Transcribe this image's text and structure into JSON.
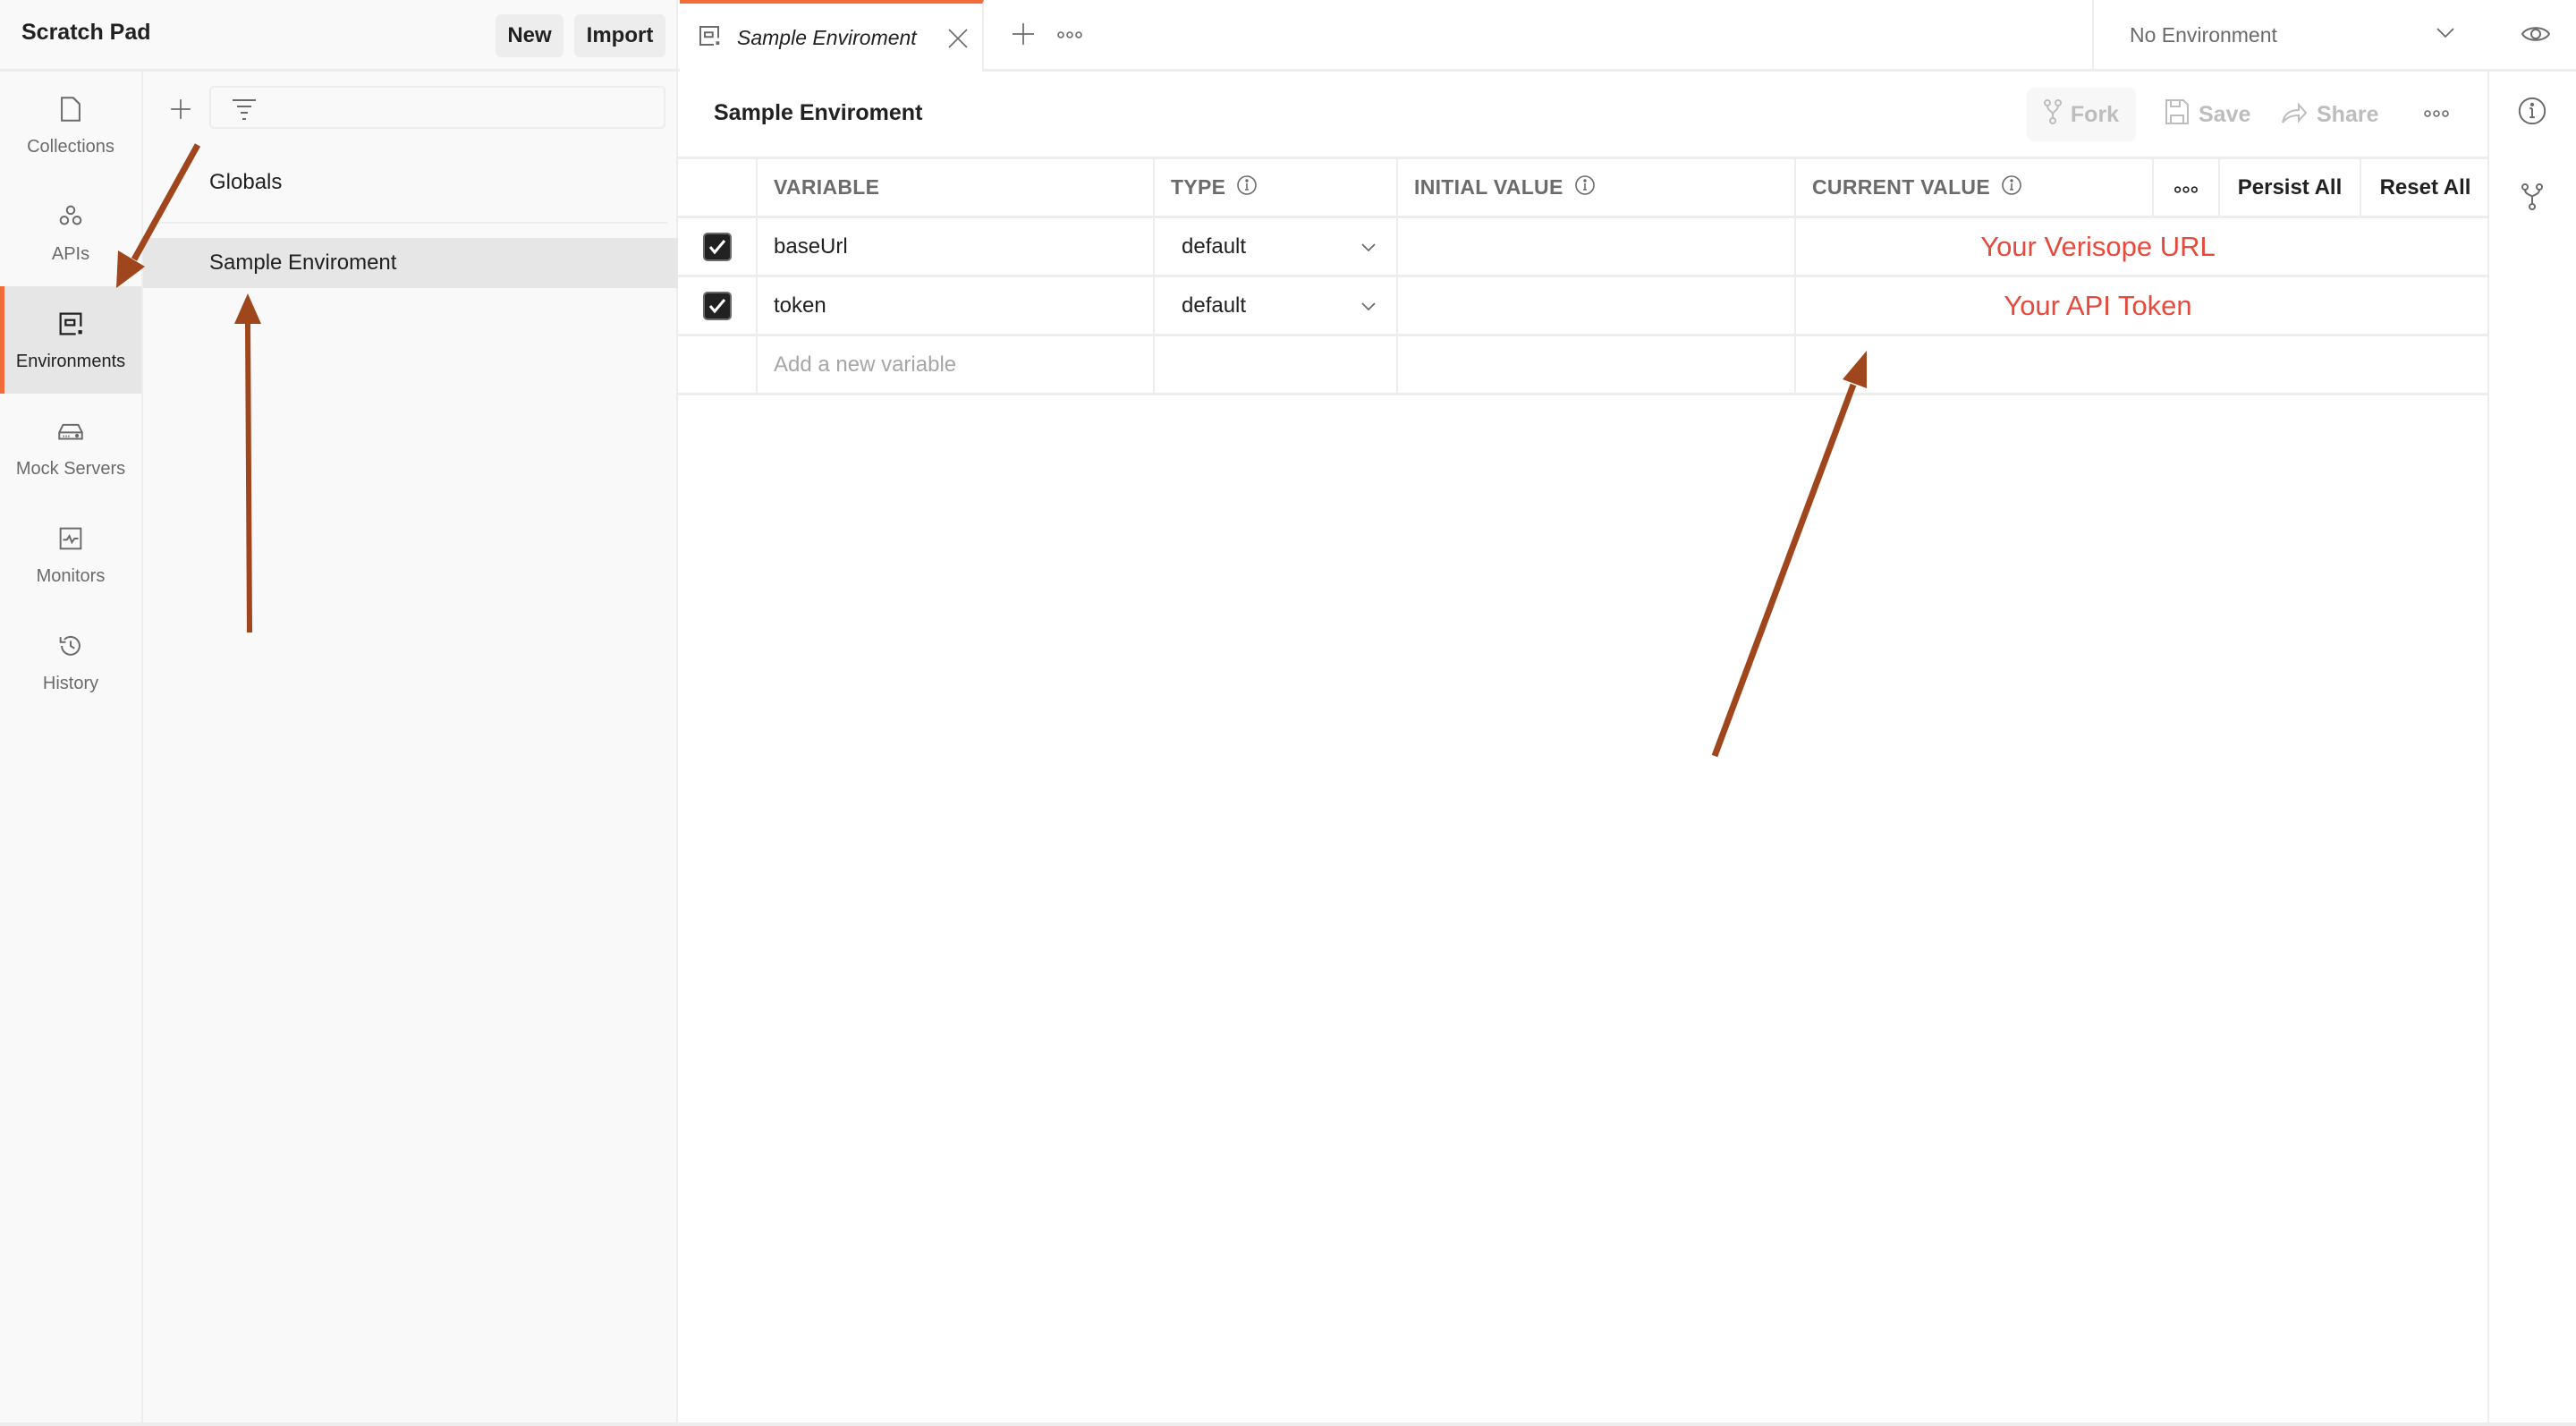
{
  "workspace": {
    "title": "Scratch Pad",
    "new_label": "New",
    "import_label": "Import"
  },
  "sidebar": {
    "items": [
      {
        "label": "Collections",
        "icon": "collections-icon",
        "active": false
      },
      {
        "label": "APIs",
        "icon": "apis-icon",
        "active": false
      },
      {
        "label": "Environments",
        "icon": "environments-icon",
        "active": true
      },
      {
        "label": "Mock Servers",
        "icon": "mock-servers-icon",
        "active": false
      },
      {
        "label": "Monitors",
        "icon": "monitors-icon",
        "active": false
      },
      {
        "label": "History",
        "icon": "history-icon",
        "active": false
      }
    ]
  },
  "env_panel": {
    "filter_placeholder": "",
    "items": [
      {
        "label": "Globals",
        "selected": false
      },
      {
        "label": "Sample Enviroment",
        "selected": true
      }
    ]
  },
  "tabs": {
    "active_tab": "Sample Enviroment",
    "environment_selector": "No Environment"
  },
  "main": {
    "title": "Sample Enviroment",
    "actions": {
      "fork": "Fork",
      "save": "Save",
      "share": "Share"
    },
    "table": {
      "headers": {
        "variable": "VARIABLE",
        "type": "TYPE",
        "initial_value": "INITIAL VALUE",
        "current_value": "CURRENT VALUE",
        "persist_all": "Persist All",
        "reset_all": "Reset All"
      },
      "rows": [
        {
          "enabled": true,
          "variable": "baseUrl",
          "type": "default",
          "initial_value": "",
          "current_value": "Your Verisope URL"
        },
        {
          "enabled": true,
          "variable": "token",
          "type": "default",
          "initial_value": "",
          "current_value": "Your API Token"
        }
      ],
      "new_variable_placeholder": "Add a new variable"
    }
  },
  "colors": {
    "accent": "#f26b3a",
    "annotation_arrow": "#a0461c",
    "current_value_text": "#e54a3d"
  }
}
